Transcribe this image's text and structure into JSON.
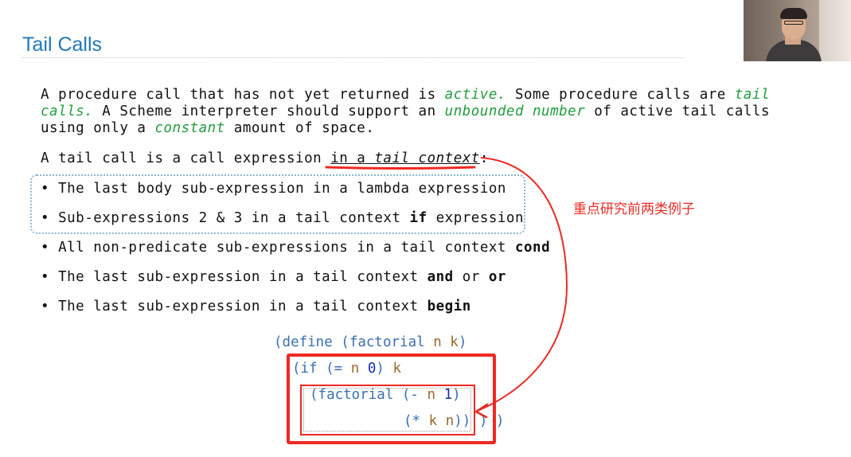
{
  "title": "Tail Calls",
  "para1": {
    "l1_a": "A procedure call that has not yet returned is ",
    "l1_active": "active.",
    "l1_b": " Some procedure calls are ",
    "l1_tail": "tail",
    "l2_calls": "calls.",
    "l2_a": " A Scheme interpreter should support an ",
    "l2_unbounded": "unbounded number",
    "l2_b": " of active tail calls",
    "l3_a": "using only a ",
    "l3_constant": "constant",
    "l3_b": " amount of space."
  },
  "para2": {
    "prefix": "A tail call is a call expression ",
    "in_a": "in a ",
    "tail_context": "tail context",
    "colon": ":"
  },
  "bullets": [
    {
      "text": "The last body sub-expression in a lambda expression",
      "bold": ""
    },
    {
      "text": "Sub-expressions 2 & 3 in a tail context ",
      "bold": "if",
      "tail": " expression"
    },
    {
      "text": "All non-predicate sub-expressions in a tail context ",
      "bold": "cond"
    },
    {
      "text": "The last sub-expression in a tail context ",
      "bold": "and",
      "mid": " or ",
      "bold2": "or"
    },
    {
      "text": "The last sub-expression in a tail context ",
      "bold": "begin"
    }
  ],
  "bullet_glyph": "•",
  "code": {
    "l1": {
      "open": "(define (factorial ",
      "n": "n",
      "sp": " ",
      "k": "k",
      "close": ")"
    },
    "l2": {
      "open": "(if (= ",
      "n": "n",
      "sp": " ",
      "zero": "0",
      "close": ") ",
      "k": "k"
    },
    "l3": {
      "open": "(factorial (- ",
      "n": "n",
      "sp": " ",
      "one": "1",
      "close": ")"
    },
    "l4": {
      "open": "(* ",
      "k": "k",
      "sp": " ",
      "n": "n",
      "close": "))",
      "outer": " ) )"
    }
  },
  "annotation": "重点研究前两类例子",
  "colors": {
    "accent": "#1d78c1",
    "green": "#1f9e3d",
    "red": "#ee2a23",
    "dotted_box": "#86b7d3"
  }
}
